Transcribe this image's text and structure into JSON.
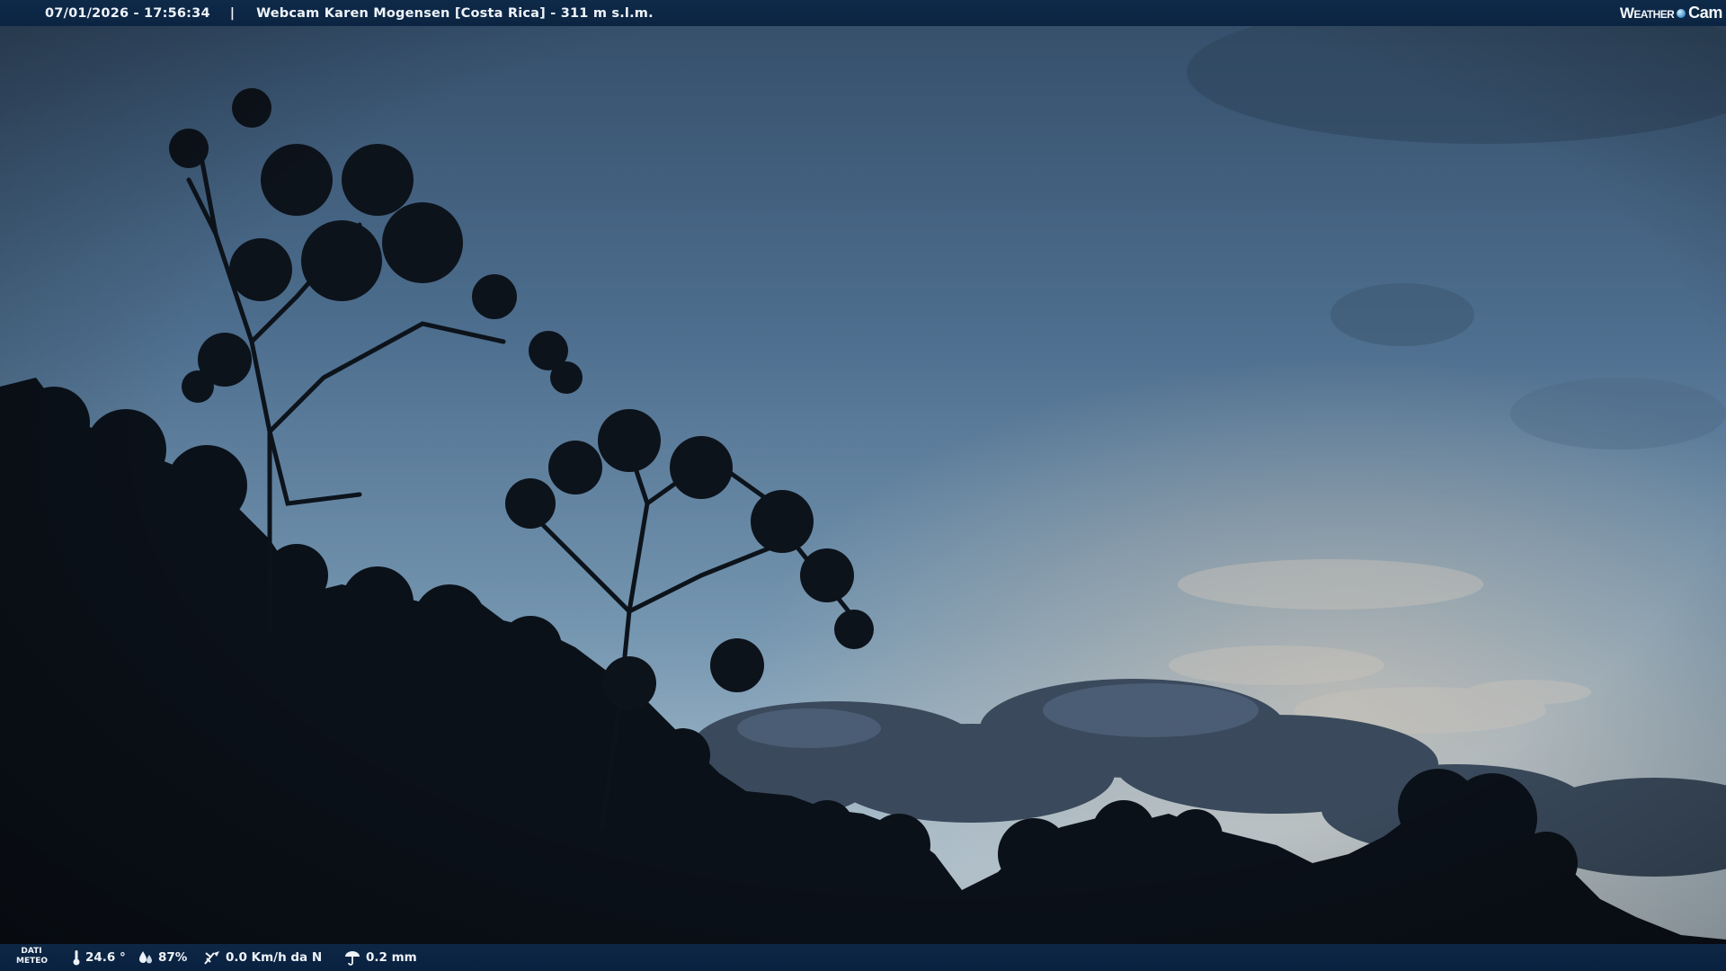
{
  "header": {
    "timestamp": "07/01/2026 - 17:56:34",
    "separator": "|",
    "title": "Webcam Karen Mogensen [Costa Rica] - 311 m s.l.m."
  },
  "logo": {
    "part1": "Weather",
    "part2": "Cam"
  },
  "weather_bar": {
    "label_line1": "DATI",
    "label_line2": "METEO",
    "temperature": "24.6 °",
    "humidity": "87%",
    "wind": "0.0 Km/h da N",
    "rain": "0.2 mm"
  },
  "icons": {
    "temperature": "thermometer-icon",
    "humidity": "water-drops-icon",
    "wind": "wind-vane-icon",
    "rain": "rain-gauge-icon",
    "logo": "weather-cam-logo-icon"
  },
  "colors": {
    "sky_top": "#3d5774",
    "sky_mid": "#5f84a3",
    "sky_horizon": "#a7bccb",
    "sunset_glow": "#d9c7b3",
    "bar_background": "#0c2643",
    "silhouette": "#0b1119"
  }
}
